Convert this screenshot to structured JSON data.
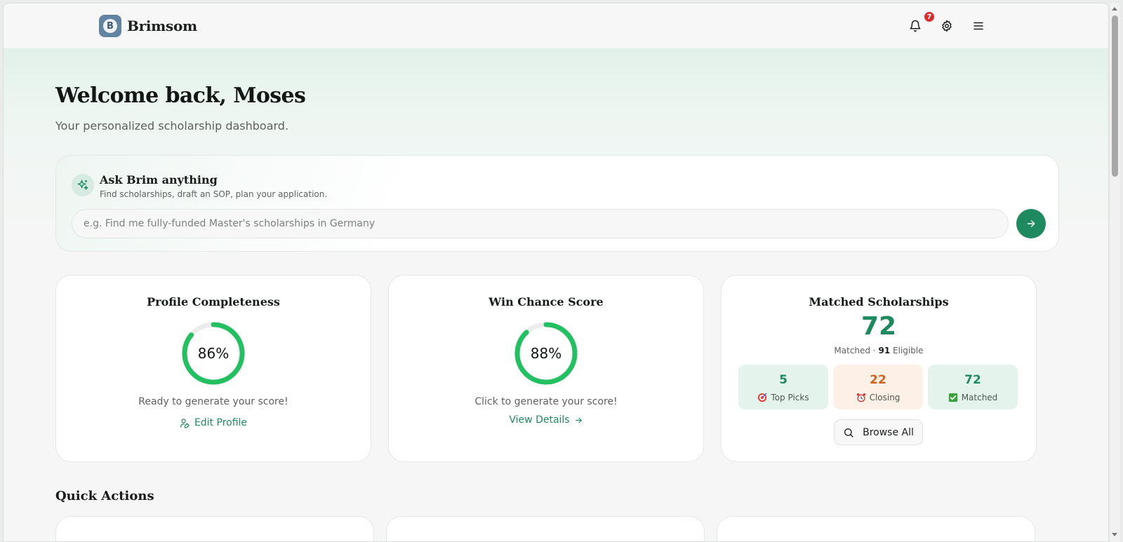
{
  "header": {
    "logo_letter": "B",
    "brand": "Brimsom",
    "notification_count": "7",
    "icons": [
      "bell-icon",
      "gear-icon",
      "menu-icon"
    ]
  },
  "hero": {
    "title": "Welcome back, Moses",
    "subtitle": "Your personalized scholarship dashboard."
  },
  "ask": {
    "title": "Ask Brim anything",
    "subtitle": "Find scholarships, draft an SOP, plan your application.",
    "placeholder": "e.g. Find me fully-funded Master's scholarships in Germany",
    "value": ""
  },
  "profile_card": {
    "title": "Profile Completeness",
    "percent_label": "86%",
    "percent": 86,
    "note": "Ready to generate your score!",
    "link": "Edit Profile"
  },
  "win_card": {
    "title": "Win Chance Score",
    "percent_label": "88%",
    "percent": 88,
    "note": "Click to generate your score!",
    "link": "View Details"
  },
  "matched_card": {
    "title": "Matched Scholarships",
    "count": "72",
    "matched_word": "Matched ·",
    "eligible_count": "91",
    "eligible_word": "Eligible",
    "stats": [
      {
        "value": "5",
        "label": "Top Picks",
        "icon": "target-icon",
        "color": "#1f8a60",
        "bg": "#e4f3ec"
      },
      {
        "value": "22",
        "label": "Closing",
        "icon": "alarm-clock-icon",
        "color": "#d4621c",
        "bg": "#fdf0e6"
      },
      {
        "value": "72",
        "label": "Matched",
        "icon": "check-box-icon",
        "color": "#1f8a60",
        "bg": "#e4f3ec"
      }
    ],
    "browse_label": "Browse All"
  },
  "quick_actions": {
    "title": "Quick Actions"
  },
  "colors": {
    "accent": "#1f8a60",
    "ring": "#22c060",
    "ring_track": "#ececec",
    "badge": "#d92d2d",
    "logo": "#6284a3"
  }
}
